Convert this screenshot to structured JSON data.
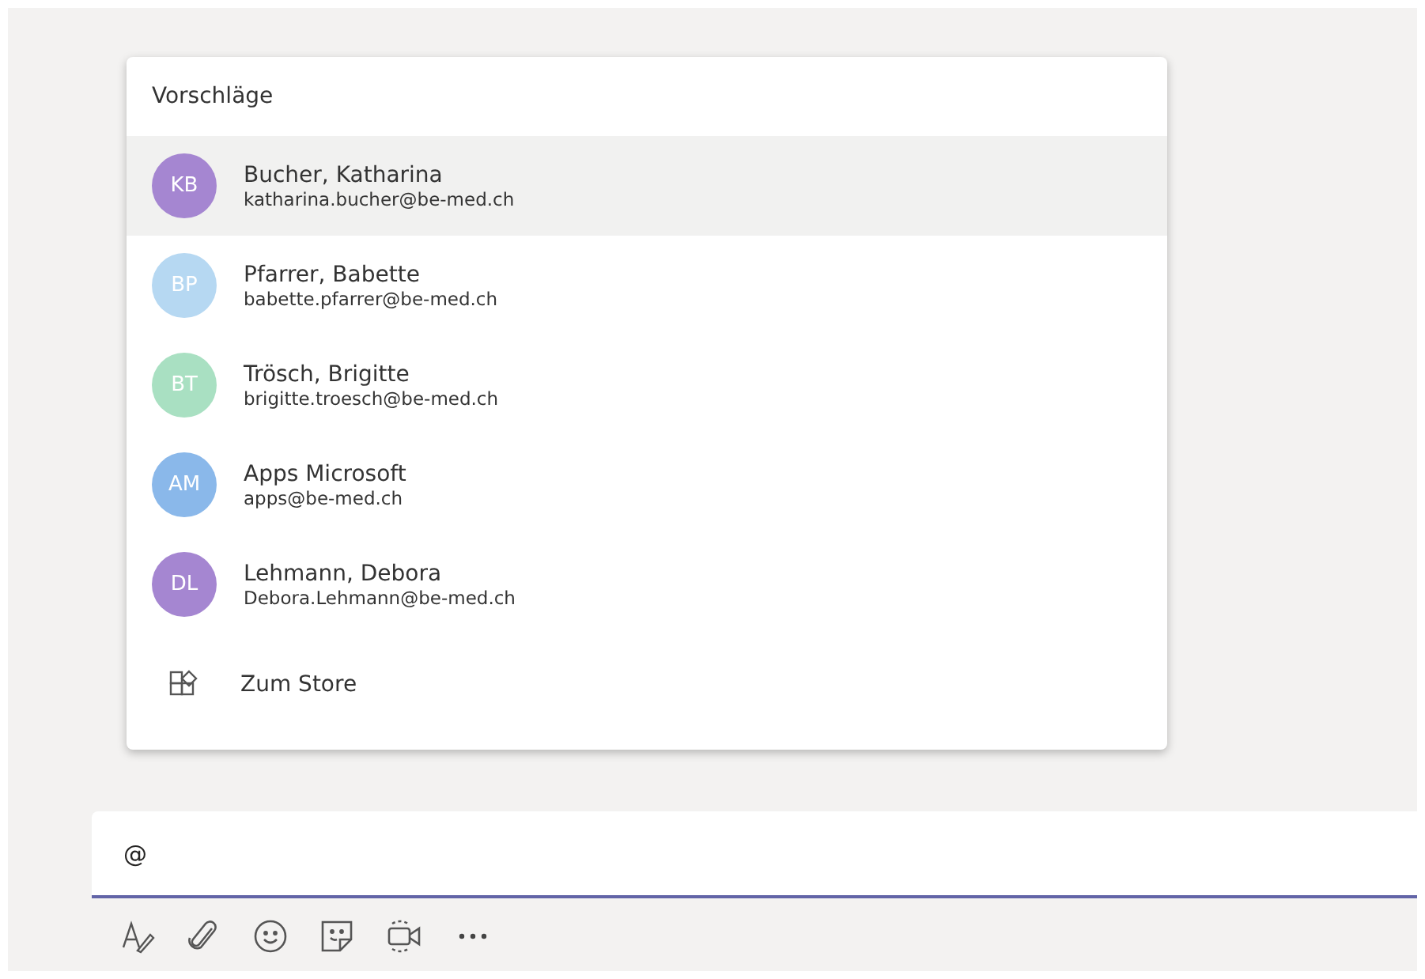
{
  "suggestions": {
    "title": "Vorschläge",
    "people": [
      {
        "initials": "KB",
        "name": "Bucher, Katharina",
        "email": "katharina.bucher@be-med.ch",
        "color": "#a586d1",
        "selected": true
      },
      {
        "initials": "BP",
        "name": "Pfarrer, Babette",
        "email": "babette.pfarrer@be-med.ch",
        "color": "#b6d8f2",
        "selected": false
      },
      {
        "initials": "BT",
        "name": "Trösch, Brigitte",
        "email": "brigitte.troesch@be-med.ch",
        "color": "#a9e0c2",
        "selected": false
      },
      {
        "initials": "AM",
        "name": "Apps Microsoft",
        "email": "apps@be-med.ch",
        "color": "#8ab8ea",
        "selected": false
      },
      {
        "initials": "DL",
        "name": "Lehmann, Debora",
        "email": "Debora.Lehmann@be-med.ch",
        "color": "#a586d1",
        "selected": false
      }
    ],
    "store": {
      "label": "Zum Store"
    }
  },
  "compose": {
    "value": "@"
  },
  "toolbar": [
    {
      "kind": "format"
    },
    {
      "kind": "attach"
    },
    {
      "kind": "emoji"
    },
    {
      "kind": "sticker"
    },
    {
      "kind": "meet"
    },
    {
      "kind": "more"
    }
  ]
}
